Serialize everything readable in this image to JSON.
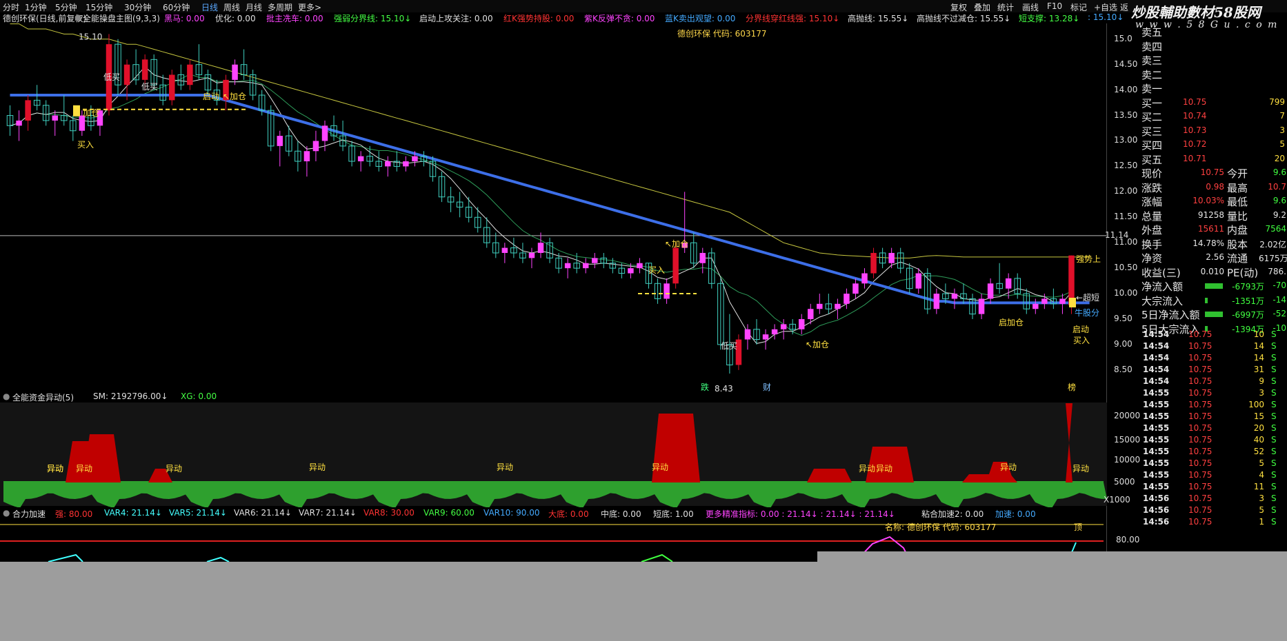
{
  "period_tabs": [
    "分时",
    "1分钟",
    "5分钟",
    "15分钟",
    "30分钟",
    "60分钟",
    "日线",
    "周线",
    "月线",
    "多周期",
    "更多>"
  ],
  "active_tab": "日线",
  "right_tools": [
    "复权",
    "叠加",
    "统计",
    "画线",
    "F10",
    "标记",
    "+自选",
    "返"
  ],
  "watermark": "炒股輔助數材58股网",
  "watermark_url": "w w w . 5 8 G u . c o m",
  "main_title": "德创环保(日线,前复权)",
  "indicator_name": "全能操盘主图(9,3,3)",
  "indicator_items": [
    {
      "label": "黑马: 0.00",
      "color": "#ff44ff"
    },
    {
      "label": "优化: 0.00",
      "color": "#e0e0e0"
    },
    {
      "label": "批主冼车: 0.00",
      "color": "#ff44ff"
    },
    {
      "label": "强弱分界线: 15.10↓",
      "color": "#44ff44"
    },
    {
      "label": "启动上攻关注: 0.00",
      "color": "#e0e0e0"
    },
    {
      "label": "红K强势持股: 0.00",
      "color": "#ff3333"
    },
    {
      "label": "紫K反弹不贪: 0.00",
      "color": "#ff44ff"
    },
    {
      "label": "蓝K卖出观望: 0.00",
      "color": "#44aaff"
    },
    {
      "label": "分界线穿红线强: 15.10↓",
      "color": "#ff3333"
    },
    {
      "label": "高抛线: 15.55↓",
      "color": "#e0e0e0"
    },
    {
      "label": "高抛线不过减仓: 15.55↓",
      "color": "#e0e0e0"
    },
    {
      "label": "短支撑: 13.28↓",
      "color": "#44ff44"
    },
    {
      "label": ": 15.10↓",
      "color": "#44aaff"
    }
  ],
  "stock_code_label": "德创环保 代码: 603177",
  "price_axis": [
    "15.0",
    "14.50",
    "14.00",
    "13.50",
    "13.00",
    "12.50",
    "12.00",
    "11.50",
    "11.14",
    "11.00",
    "10.50",
    "10.00",
    "9.50",
    "9.00",
    "8.50"
  ],
  "chart_annotations": [
    {
      "text": "15.10",
      "kind": "high"
    },
    {
      "text": "8.43",
      "kind": "low"
    },
    {
      "text": "低买"
    },
    {
      "text": "低买"
    },
    {
      "text": "低买"
    },
    {
      "text": "启动"
    },
    {
      "text": "↖加仓"
    },
    {
      "text": "加仓"
    },
    {
      "text": "买入"
    },
    {
      "text": "↖加仓"
    },
    {
      "text": "买入"
    },
    {
      "text": "↖加仓"
    },
    {
      "text": "启加仓"
    },
    {
      "text": "启动"
    },
    {
      "text": "买入"
    },
    {
      "text": "强势上"
    },
    {
      "text": "←超短"
    },
    {
      "text": "牛股分"
    },
    {
      "text": "跌"
    },
    {
      "text": "财"
    },
    {
      "text": "榜"
    }
  ],
  "panel2": {
    "title": "全能资金异动(5)",
    "sm": "SM: 2192796.00↓",
    "xg": "XG: 0.00",
    "axis": [
      "20000",
      "15000",
      "10000",
      "5000",
      "X1000"
    ],
    "labels": [
      "异动",
      "异动",
      "异动",
      "异动",
      "异动",
      "异动",
      "异动",
      "异动",
      "异动",
      "异动",
      "异动"
    ]
  },
  "panel3": {
    "title": "合力加速",
    "items": [
      {
        "label": "强: 80.00",
        "color": "#ff3333"
      },
      {
        "label": "VAR4: 21.14↓",
        "color": "#44ffff"
      },
      {
        "label": "VAR5: 21.14↓",
        "color": "#44ffff"
      },
      {
        "label": "VAR6: 21.14↓",
        "color": "#e0e0e0"
      },
      {
        "label": "VAR7: 21.14↓",
        "color": "#e0e0e0"
      },
      {
        "label": "VAR8: 30.00",
        "color": "#ff3333"
      },
      {
        "label": "VAR9: 60.00",
        "color": "#44ff44"
      },
      {
        "label": "VAR10: 90.00",
        "color": "#44aaff"
      },
      {
        "label": "大底: 0.00",
        "color": "#ff3333"
      },
      {
        "label": "中底: 0.00",
        "color": "#e0e0e0"
      },
      {
        "label": "短底: 1.00",
        "color": "#e0e0e0"
      },
      {
        "label": "更多精准指标: 0.00 : 21.14↓ : 21.14↓ : 21.14↓",
        "color": "#ff44ff"
      },
      {
        "label": "粘合加速2: 0.00",
        "color": "#e0e0e0"
      },
      {
        "label": "加速: 0.00",
        "color": "#44aaff"
      }
    ],
    "name_label": "名称: 德创环保 代码: 603177",
    "top_tag": "顶",
    "axis": [
      "80.00"
    ]
  },
  "order_book": {
    "sell": [
      "卖五",
      "卖四",
      "卖三",
      "卖二",
      "卖一"
    ],
    "buy": [
      {
        "label": "买一",
        "price": "10.75",
        "vol": "799"
      },
      {
        "label": "买二",
        "price": "10.74",
        "vol": "7"
      },
      {
        "label": "买三",
        "price": "10.73",
        "vol": "3"
      },
      {
        "label": "买四",
        "price": "10.72",
        "vol": "5"
      },
      {
        "label": "买五",
        "price": "10.71",
        "vol": "20"
      }
    ]
  },
  "quote": [
    {
      "l": "现价",
      "v": "10.75",
      "l2": "今开",
      "v2": "9.6"
    },
    {
      "l": "涨跌",
      "v": "0.98",
      "l2": "最高",
      "v2": "10.7"
    },
    {
      "l": "涨幅",
      "v": "10.03%",
      "l2": "最低",
      "v2": "9.6"
    },
    {
      "l": "总量",
      "v": "91258",
      "l2": "量比",
      "v2": "9.2"
    },
    {
      "l": "外盘",
      "v": "15611",
      "l2": "内盘",
      "v2": "7564"
    },
    {
      "l": "换手",
      "v": "14.78%",
      "l2": "股本",
      "v2": "2.02亿"
    },
    {
      "l": "净资",
      "v": "2.56",
      "l2": "流通",
      "v2": "6175万"
    },
    {
      "l": "收益(三)",
      "v": "0.010",
      "l2": "PE(动)",
      "v2": "786."
    }
  ],
  "flows": [
    {
      "l": "净流入额",
      "v": "-6793万",
      "v2": "-70"
    },
    {
      "l": "大宗流入",
      "v": "-1351万",
      "v2": "-14"
    },
    {
      "l": "5日净流入额",
      "v": "-6997万",
      "v2": "-52"
    },
    {
      "l": "5日大宗流入",
      "v": "-1394万",
      "v2": "-10"
    }
  ],
  "ticks": [
    {
      "t": "14:54",
      "p": "10.75",
      "v": "10",
      "s": "S"
    },
    {
      "t": "14:54",
      "p": "10.75",
      "v": "14",
      "s": "S"
    },
    {
      "t": "14:54",
      "p": "10.75",
      "v": "14",
      "s": "S"
    },
    {
      "t": "14:54",
      "p": "10.75",
      "v": "31",
      "s": "S"
    },
    {
      "t": "14:54",
      "p": "10.75",
      "v": "9",
      "s": "S"
    },
    {
      "t": "14:55",
      "p": "10.75",
      "v": "3",
      "s": "S"
    },
    {
      "t": "14:55",
      "p": "10.75",
      "v": "100",
      "s": "S"
    },
    {
      "t": "14:55",
      "p": "10.75",
      "v": "15",
      "s": "S"
    },
    {
      "t": "14:55",
      "p": "10.75",
      "v": "20",
      "s": "S"
    },
    {
      "t": "14:55",
      "p": "10.75",
      "v": "40",
      "s": "S"
    },
    {
      "t": "14:55",
      "p": "10.75",
      "v": "52",
      "s": "S"
    },
    {
      "t": "14:55",
      "p": "10.75",
      "v": "5",
      "s": "S"
    },
    {
      "t": "14:55",
      "p": "10.75",
      "v": "4",
      "s": "S"
    },
    {
      "t": "14:55",
      "p": "10.75",
      "v": "11",
      "s": "S"
    },
    {
      "t": "14:56",
      "p": "10.75",
      "v": "3",
      "s": "S"
    },
    {
      "t": "14:56",
      "p": "10.75",
      "v": "5",
      "s": "S"
    },
    {
      "t": "14:56",
      "p": "10.75",
      "v": "1",
      "s": "S"
    }
  ],
  "chart_data": {
    "type": "candlestick",
    "title": "德创环保(日线,前复权)",
    "ylim": [
      8.2,
      15.2
    ],
    "reference_price": 11.14,
    "candles": [
      [
        13.5,
        13.7,
        13.1,
        13.3
      ],
      [
        13.3,
        13.6,
        13.0,
        13.4
      ],
      [
        13.4,
        13.9,
        13.2,
        13.8
      ],
      [
        13.8,
        14.1,
        13.6,
        13.7
      ],
      [
        13.7,
        13.8,
        13.3,
        13.4
      ],
      [
        13.4,
        13.6,
        13.1,
        13.5
      ],
      [
        13.5,
        13.9,
        13.3,
        13.4
      ],
      [
        13.4,
        13.5,
        13.0,
        13.2
      ],
      [
        13.2,
        13.6,
        13.1,
        13.5
      ],
      [
        13.5,
        13.7,
        13.2,
        13.3
      ],
      [
        13.3,
        13.6,
        13.1,
        13.6
      ],
      [
        13.6,
        15.1,
        13.5,
        14.9
      ],
      [
        14.9,
        15.0,
        13.9,
        14.1
      ],
      [
        14.1,
        14.6,
        13.8,
        14.5
      ],
      [
        14.5,
        14.8,
        14.1,
        14.2
      ],
      [
        14.2,
        14.7,
        14.0,
        14.6
      ],
      [
        14.6,
        14.7,
        14.0,
        14.1
      ],
      [
        14.1,
        14.3,
        13.7,
        13.8
      ],
      [
        13.8,
        14.4,
        13.7,
        14.3
      ],
      [
        14.3,
        14.5,
        14.0,
        14.1
      ],
      [
        14.1,
        14.6,
        14.0,
        14.5
      ],
      [
        14.5,
        14.9,
        14.2,
        14.3
      ],
      [
        14.3,
        14.4,
        13.9,
        14.0
      ],
      [
        14.0,
        14.2,
        13.7,
        13.8
      ],
      [
        13.8,
        14.3,
        13.6,
        14.2
      ],
      [
        14.2,
        14.6,
        14.1,
        14.5
      ],
      [
        14.5,
        14.8,
        14.2,
        14.3
      ],
      [
        14.3,
        14.4,
        13.8,
        13.9
      ],
      [
        13.9,
        14.0,
        13.5,
        13.6
      ],
      [
        13.6,
        13.7,
        12.8,
        12.9
      ],
      [
        12.9,
        13.2,
        12.5,
        13.1
      ],
      [
        13.1,
        13.3,
        12.7,
        12.8
      ],
      [
        12.8,
        13.0,
        12.4,
        12.6
      ],
      [
        12.6,
        12.9,
        12.3,
        12.8
      ],
      [
        12.8,
        13.2,
        12.6,
        13.0
      ],
      [
        13.0,
        13.4,
        12.8,
        13.3
      ],
      [
        13.3,
        13.5,
        13.0,
        13.1
      ],
      [
        13.1,
        13.4,
        12.8,
        12.9
      ],
      [
        12.9,
        13.0,
        12.5,
        12.6
      ],
      [
        12.6,
        12.8,
        12.4,
        12.7
      ],
      [
        12.7,
        12.9,
        12.5,
        12.6
      ],
      [
        12.6,
        12.8,
        12.4,
        12.5
      ],
      [
        12.5,
        12.7,
        12.3,
        12.6
      ],
      [
        12.6,
        12.8,
        12.4,
        12.5
      ],
      [
        12.5,
        12.7,
        12.4,
        12.6
      ],
      [
        12.6,
        12.8,
        12.5,
        12.7
      ],
      [
        12.7,
        12.8,
        12.5,
        12.6
      ],
      [
        12.6,
        12.7,
        12.2,
        12.3
      ],
      [
        12.3,
        12.4,
        11.8,
        11.9
      ],
      [
        11.9,
        12.1,
        11.6,
        11.8
      ],
      [
        11.8,
        12.0,
        11.5,
        11.7
      ],
      [
        11.7,
        11.9,
        11.4,
        11.5
      ],
      [
        11.5,
        11.7,
        11.2,
        11.3
      ],
      [
        11.3,
        11.5,
        10.9,
        11.0
      ],
      [
        11.0,
        11.2,
        10.7,
        10.8
      ],
      [
        10.8,
        11.0,
        10.6,
        10.9
      ],
      [
        10.9,
        11.1,
        10.7,
        10.8
      ],
      [
        10.8,
        11.0,
        10.6,
        10.7
      ],
      [
        10.7,
        10.9,
        10.5,
        10.8
      ],
      [
        10.8,
        11.2,
        10.7,
        11.0
      ],
      [
        11.0,
        11.1,
        10.6,
        10.7
      ],
      [
        10.7,
        10.8,
        10.4,
        10.5
      ],
      [
        10.5,
        10.7,
        10.3,
        10.6
      ],
      [
        10.6,
        10.8,
        10.4,
        10.5
      ],
      [
        10.5,
        10.7,
        10.4,
        10.6
      ],
      [
        10.6,
        10.8,
        10.5,
        10.7
      ],
      [
        10.7,
        10.8,
        10.5,
        10.6
      ],
      [
        10.6,
        10.7,
        10.4,
        10.5
      ],
      [
        10.5,
        10.6,
        10.3,
        10.4
      ],
      [
        10.4,
        10.6,
        10.3,
        10.5
      ],
      [
        10.5,
        10.7,
        10.4,
        10.6
      ],
      [
        10.6,
        10.6,
        10.1,
        10.2
      ],
      [
        10.2,
        10.3,
        9.8,
        9.9
      ],
      [
        9.9,
        10.3,
        9.8,
        10.2
      ],
      [
        10.2,
        11.0,
        10.1,
        10.9
      ],
      [
        10.9,
        12.0,
        10.8,
        11.0
      ],
      [
        11.0,
        11.2,
        10.5,
        10.6
      ],
      [
        10.6,
        10.9,
        10.4,
        10.8
      ],
      [
        10.8,
        10.9,
        10.1,
        10.2
      ],
      [
        10.2,
        10.3,
        8.9,
        9.0
      ],
      [
        9.0,
        9.6,
        8.43,
        8.6
      ],
      [
        8.6,
        9.2,
        8.5,
        9.1
      ],
      [
        9.1,
        9.4,
        8.9,
        9.3
      ],
      [
        9.3,
        9.5,
        9.0,
        9.1
      ],
      [
        9.1,
        9.3,
        8.9,
        9.2
      ],
      [
        9.2,
        9.4,
        9.1,
        9.3
      ],
      [
        9.3,
        9.5,
        9.1,
        9.4
      ],
      [
        9.4,
        9.5,
        9.2,
        9.3
      ],
      [
        9.3,
        9.6,
        9.2,
        9.5
      ],
      [
        9.5,
        9.8,
        9.4,
        9.7
      ],
      [
        9.7,
        10.0,
        9.6,
        9.8
      ],
      [
        9.8,
        10.0,
        9.6,
        9.7
      ],
      [
        9.7,
        9.9,
        9.5,
        9.8
      ],
      [
        9.8,
        10.1,
        9.7,
        10.0
      ],
      [
        10.0,
        10.3,
        9.9,
        10.2
      ],
      [
        10.2,
        10.5,
        10.1,
        10.4
      ],
      [
        10.4,
        10.9,
        10.3,
        10.8
      ],
      [
        10.8,
        10.9,
        10.5,
        10.6
      ],
      [
        10.6,
        10.9,
        10.5,
        10.8
      ],
      [
        10.8,
        10.9,
        10.4,
        10.5
      ],
      [
        10.5,
        10.6,
        10.0,
        10.1
      ],
      [
        10.1,
        10.5,
        10.0,
        10.4
      ],
      [
        10.4,
        10.5,
        9.6,
        9.7
      ],
      [
        9.7,
        10.1,
        9.6,
        10.0
      ],
      [
        10.0,
        10.2,
        9.8,
        9.9
      ],
      [
        9.9,
        10.1,
        9.7,
        10.0
      ],
      [
        10.0,
        10.2,
        9.8,
        9.9
      ],
      [
        9.9,
        10.0,
        9.5,
        9.6
      ],
      [
        9.6,
        10.0,
        9.5,
        9.9
      ],
      [
        9.9,
        10.3,
        9.8,
        10.2
      ],
      [
        10.2,
        10.6,
        10.0,
        10.1
      ],
      [
        10.1,
        10.4,
        9.9,
        10.3
      ],
      [
        10.3,
        10.4,
        9.9,
        10.0
      ],
      [
        10.0,
        10.1,
        9.6,
        9.7
      ],
      [
        9.7,
        9.9,
        9.6,
        9.8
      ],
      [
        9.8,
        10.0,
        9.7,
        9.9
      ],
      [
        9.9,
        10.1,
        9.7,
        9.8
      ],
      [
        9.8,
        10.0,
        9.6,
        9.9
      ],
      [
        9.77,
        10.75,
        9.6,
        10.75
      ]
    ],
    "ma_long": [
      13.9,
      13.9,
      13.9,
      13.9,
      13.9,
      13.9,
      13.9,
      13.9,
      13.9,
      13.9,
      13.9,
      13.9,
      13.9,
      13.9,
      13.9,
      13.9,
      13.9,
      13.9,
      13.9,
      13.9,
      13.9,
      13.9,
      13.9,
      13.85,
      13.8,
      13.75,
      13.7,
      13.65,
      13.6,
      13.55,
      13.5,
      13.45,
      13.4,
      13.35,
      13.3,
      13.25,
      13.2,
      13.15,
      13.1,
      13.05,
      13.0,
      12.95,
      12.9,
      12.85,
      12.8,
      12.75,
      12.7,
      12.65,
      12.6,
      12.55,
      12.5,
      12.45,
      12.4,
      12.35,
      12.3,
      12.25,
      12.2,
      12.15,
      12.1,
      12.05,
      12.0,
      11.95,
      11.9,
      11.85,
      11.8,
      11.75,
      11.7,
      11.65,
      11.6,
      11.55,
      11.5,
      11.45,
      11.4,
      11.35,
      11.3,
      11.25,
      11.2,
      11.15,
      11.1,
      11.05,
      11.0,
      10.95,
      10.9,
      10.85,
      10.8,
      10.75,
      10.7,
      10.65,
      10.6,
      10.55,
      10.5,
      10.45,
      10.4,
      10.35,
      10.3,
      10.25,
      10.2,
      10.15,
      10.1,
      10.05,
      10.0,
      9.95,
      9.9,
      9.85,
      9.85,
      9.82,
      9.82,
      9.82,
      9.82,
      9.82,
      9.82,
      9.82,
      9.82,
      9.82,
      9.82,
      9.82,
      9.82,
      9.82,
      9.82,
      9.82,
      9.82
    ],
    "band_upper": [
      15.3,
      15.3,
      15.2,
      15.2,
      15.2,
      15.15,
      15.1,
      15.1,
      15.05,
      15.0,
      15.0,
      15.0,
      14.95,
      14.9,
      14.9,
      14.85,
      14.8,
      14.75,
      14.7,
      14.65,
      14.6,
      14.55,
      14.5,
      14.45,
      14.4,
      14.35,
      14.3,
      14.25,
      14.2,
      14.15,
      14.1,
      14.05,
      14.0,
      13.95,
      13.9,
      13.85,
      13.8,
      13.75,
      13.7,
      13.65,
      13.6,
      13.55,
      13.5,
      13.45,
      13.4,
      13.35,
      13.3,
      13.25,
      13.2,
      13.15,
      13.1,
      13.05,
      13.0,
      12.95,
      12.9,
      12.85,
      12.8,
      12.75,
      12.7,
      12.65,
      12.6,
      12.55,
      12.5,
      12.45,
      12.4,
      12.35,
      12.3,
      12.25,
      12.2,
      12.15,
      12.1,
      12.05,
      12.0,
      11.95,
      11.9,
      11.85,
      11.8,
      11.75,
      11.7,
      11.65,
      11.6,
      11.5,
      11.4,
      11.3,
      11.2,
      11.1,
      11.0,
      10.95,
      10.9,
      10.85,
      10.8,
      10.78,
      10.76,
      10.75,
      10.74,
      10.73,
      10.72,
      10.71,
      10.7,
      10.7,
      10.7,
      10.72,
      10.74,
      10.75,
      10.74,
      10.73,
      10.72,
      10.72,
      10.72,
      10.72,
      10.72,
      10.72,
      10.72,
      10.72,
      10.72,
      10.72,
      10.72,
      10.72,
      10.72,
      10.72,
      10.72
    ],
    "legend_series": [
      "强弱分界线",
      "短支撑",
      "高抛线"
    ]
  }
}
